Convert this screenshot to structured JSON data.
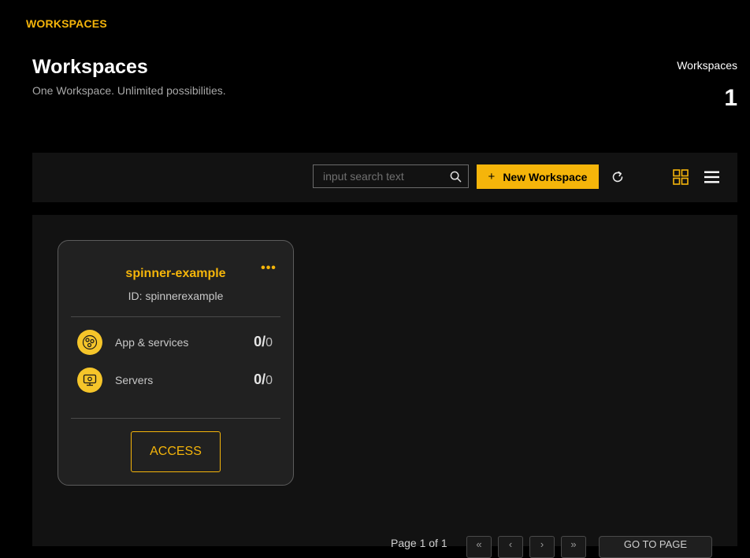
{
  "brand": {
    "label": "WORKSPACES"
  },
  "header": {
    "title": "Workspaces",
    "subtitle": "One Workspace. Unlimited possibilities.",
    "stat_label": "Workspaces",
    "stat_count": "1"
  },
  "toolbar": {
    "search_placeholder": "input search text",
    "search_value": "",
    "new_button_plus": "+",
    "new_button_label": "New Workspace"
  },
  "workspaces": [
    {
      "name": "spinner-example",
      "id_label": "ID:",
      "id_value": "spinnerexample",
      "metrics": [
        {
          "label": "App & services",
          "current": "0",
          "total": "0",
          "icon": "apps-icon"
        },
        {
          "label": "Servers",
          "current": "0",
          "total": "0",
          "icon": "server-icon"
        }
      ],
      "access_label": "ACCESS"
    }
  ],
  "pagination": {
    "page_text": "Page 1 of 1",
    "first": "«",
    "prev": "‹",
    "next": "›",
    "last": "»",
    "goto_label": "GO TO PAGE"
  },
  "colors": {
    "accent": "#f5b50a",
    "background": "#000000",
    "panel": "#121212",
    "card": "#212121"
  }
}
